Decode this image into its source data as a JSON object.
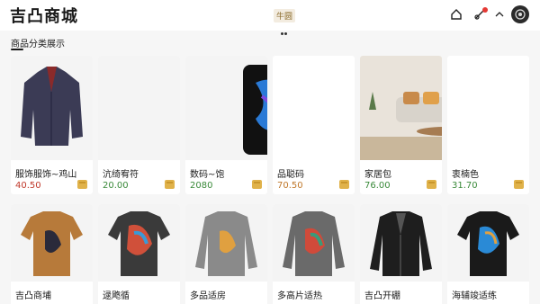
{
  "header": {
    "title": "吉凸商城",
    "center_tag": "牛圆"
  },
  "section": {
    "title": "商品分类展示"
  },
  "colors": {
    "price_red": "#c0392b",
    "price_green": "#3a8a3a",
    "price_orange": "#c0782b",
    "cart_gold": "#e0b24a"
  },
  "products_row1": [
    {
      "name": "服饰服饰~鸡山",
      "price": "40.50",
      "price_color": "#c0392b",
      "icon": "jacket-image"
    },
    {
      "name": "沆绮宥符",
      "price": "20.00",
      "price_color": "#3a8a3a",
      "icon": "jacket-image"
    },
    {
      "name": "数码~饱",
      "price": "2080",
      "price_color": "#3a8a3a",
      "icon": "phone-image"
    },
    {
      "name": "品聪码",
      "price": "70.50",
      "price_color": "#c0782b",
      "icon": "phone-image"
    },
    {
      "name": "家居包",
      "price": "76.00",
      "price_color": "#3a8a3a",
      "icon": "living-room-image"
    },
    {
      "name": "衷楠色",
      "price": "31.70",
      "price_color": "#3a8a3a",
      "icon": "living-room-image"
    }
  ],
  "products_row2": [
    {
      "name": "吉凸商埔",
      "icon": "tshirt-image"
    },
    {
      "name": "逯飑循",
      "icon": "tshirt-image"
    },
    {
      "name": "多品适房",
      "icon": "sweater-image"
    },
    {
      "name": "多高片适热",
      "icon": "sweater-image"
    },
    {
      "name": "吉凸开硼",
      "icon": "leather-jacket-image"
    },
    {
      "name": "海辅竣适练",
      "icon": "tshirt-image"
    }
  ]
}
